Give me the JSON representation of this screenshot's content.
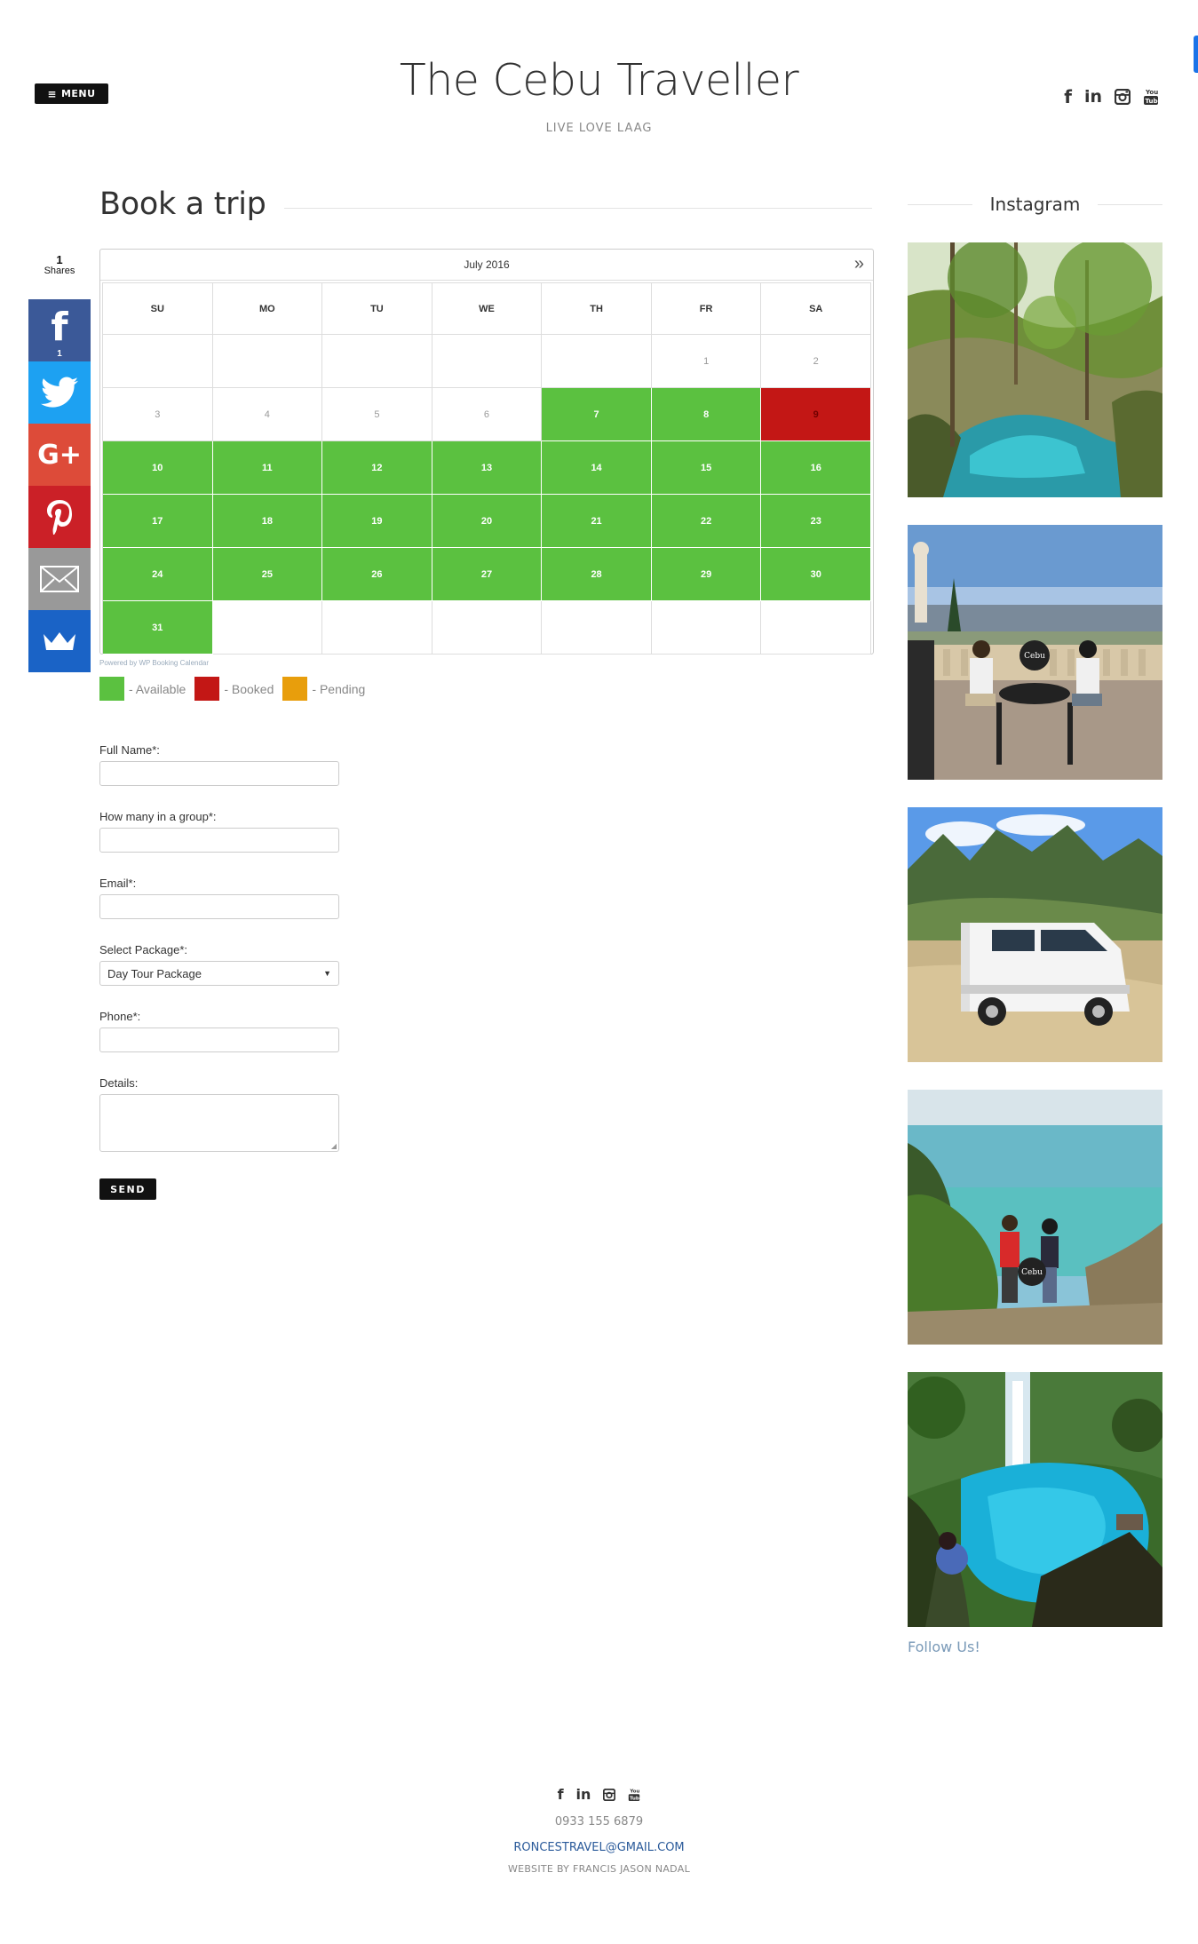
{
  "header": {
    "menu_label": "MENU",
    "site_title": "The Cebu Traveller",
    "tagline": "LIVE LOVE LAAG",
    "social_icons": [
      "facebook-icon",
      "linkedin-icon",
      "instagram-icon",
      "youtube-icon"
    ]
  },
  "share": {
    "count": "1",
    "count_label": "Shares",
    "facebook_count": "1",
    "buttons": [
      "facebook",
      "twitter",
      "google-plus",
      "pinterest",
      "email",
      "sumome"
    ]
  },
  "main": {
    "title": "Book a trip"
  },
  "calendar": {
    "month": "July 2016",
    "next_glyph": "»",
    "days_of_week": [
      "SU",
      "MO",
      "TU",
      "WE",
      "TH",
      "FR",
      "SA"
    ],
    "cells": [
      {
        "label": "",
        "status": "none"
      },
      {
        "label": "",
        "status": "none"
      },
      {
        "label": "",
        "status": "none"
      },
      {
        "label": "",
        "status": "none"
      },
      {
        "label": "",
        "status": "none"
      },
      {
        "label": "1",
        "status": "past"
      },
      {
        "label": "2",
        "status": "past"
      },
      {
        "label": "3",
        "status": "past"
      },
      {
        "label": "4",
        "status": "past"
      },
      {
        "label": "5",
        "status": "past"
      },
      {
        "label": "6",
        "status": "past"
      },
      {
        "label": "7",
        "status": "available"
      },
      {
        "label": "8",
        "status": "available"
      },
      {
        "label": "9",
        "status": "booked"
      },
      {
        "label": "10",
        "status": "available"
      },
      {
        "label": "11",
        "status": "available"
      },
      {
        "label": "12",
        "status": "available"
      },
      {
        "label": "13",
        "status": "available"
      },
      {
        "label": "14",
        "status": "available"
      },
      {
        "label": "15",
        "status": "available"
      },
      {
        "label": "16",
        "status": "available"
      },
      {
        "label": "17",
        "status": "available"
      },
      {
        "label": "18",
        "status": "available"
      },
      {
        "label": "19",
        "status": "available"
      },
      {
        "label": "20",
        "status": "available"
      },
      {
        "label": "21",
        "status": "available"
      },
      {
        "label": "22",
        "status": "available"
      },
      {
        "label": "23",
        "status": "available"
      },
      {
        "label": "24",
        "status": "available"
      },
      {
        "label": "25",
        "status": "available"
      },
      {
        "label": "26",
        "status": "available"
      },
      {
        "label": "27",
        "status": "available"
      },
      {
        "label": "28",
        "status": "available"
      },
      {
        "label": "29",
        "status": "available"
      },
      {
        "label": "30",
        "status": "available"
      },
      {
        "label": "31",
        "status": "available"
      },
      {
        "label": "",
        "status": "none"
      },
      {
        "label": "",
        "status": "none"
      },
      {
        "label": "",
        "status": "none"
      },
      {
        "label": "",
        "status": "none"
      },
      {
        "label": "",
        "status": "none"
      },
      {
        "label": "",
        "status": "none"
      }
    ],
    "powered_by": "Powered by WP Booking Calendar",
    "legend": [
      {
        "label": "- Available",
        "color": "#5bc140"
      },
      {
        "label": "- Booked",
        "color": "#c31715"
      },
      {
        "label": "- Pending",
        "color": "#e89e0c"
      }
    ]
  },
  "form": {
    "full_name_label": "Full Name*:",
    "full_name_value": "",
    "group_label": "How many in a group*:",
    "group_value": "",
    "email_label": "Email*:",
    "email_value": "",
    "package_label": "Select Package*:",
    "package_value": "Day Tour Package",
    "phone_label": "Phone*:",
    "phone_value": "",
    "details_label": "Details:",
    "details_value": "",
    "send_label": "SEND"
  },
  "sidebar": {
    "title": "Instagram",
    "photos": [
      "river-canyon-photo",
      "couple-on-terrace-photo",
      "white-van-mountains-photo",
      "couple-on-cliff-sea-photo",
      "waterfall-blue-lagoon-photo"
    ],
    "follow_label": "Follow Us!"
  },
  "footer": {
    "social_icons": [
      "facebook-icon",
      "linkedin-icon",
      "instagram-icon",
      "youtube-icon"
    ],
    "phone": "0933 155 6879",
    "email": "RONCESTRAVEL@GMAIL.COM",
    "credit": "WEBSITE BY FRANCIS JASON NADAL"
  },
  "colors": {
    "available": "#5bc140",
    "booked": "#c31715",
    "pending": "#e89e0c",
    "facebook": "#3b5998",
    "twitter": "#1da1f2",
    "google_plus": "#dd4b39",
    "pinterest": "#cb2027",
    "email": "#999999",
    "sumome": "#1a63c6"
  }
}
